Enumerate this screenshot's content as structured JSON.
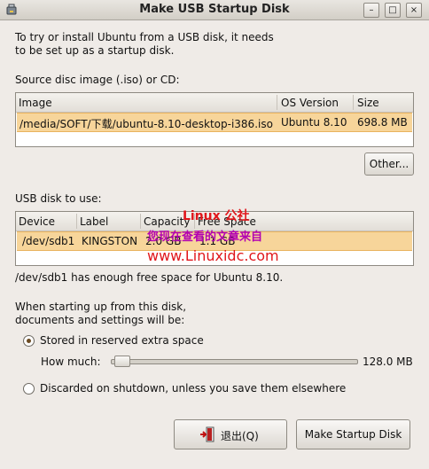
{
  "window": {
    "title": "Make USB Startup Disk"
  },
  "titlebar_buttons": {
    "minimize": "–",
    "maximize": "□",
    "close": "×"
  },
  "intro": {
    "line1": "To try or install Ubuntu from a USB disk, it needs",
    "line2": "to be set up as a startup disk."
  },
  "source": {
    "label": "Source disc image (.iso) or CD:",
    "columns": {
      "image": "Image",
      "os_version": "OS Version",
      "size": "Size"
    },
    "rows": [
      {
        "image": "/media/SOFT/下载/ubuntu-8.10-desktop-i386.iso",
        "os_version": "Ubuntu 8.10",
        "size": "698.8 MB"
      }
    ],
    "other_button": "Other..."
  },
  "usb": {
    "label": "USB disk to use:",
    "columns": {
      "device": "Device",
      "label": "Label",
      "capacity": "Capacity",
      "free_space": "Free Space"
    },
    "rows": [
      {
        "device": "/dev/sdb1",
        "label": "KINGSTON",
        "capacity": "2.0 GB",
        "free_space": "1.1 GB"
      }
    ],
    "status": "/dev/sdb1 has enough free space for Ubuntu 8.10."
  },
  "persistence": {
    "intro_line1": "When starting up from this disk,",
    "intro_line2": "documents and settings will be:",
    "option_stored": "Stored in reserved extra space",
    "how_much_label": "How much:",
    "how_much_value": "128.0 MB",
    "slider_fraction": 0.02,
    "option_discarded": "Discarded on shutdown, unless you save them elsewhere",
    "selected": "stored"
  },
  "buttons": {
    "quit": "退出(Q)",
    "make": "Make Startup Disk"
  },
  "watermark": {
    "line1": "Linux 公社",
    "line2": "您现在查看的文章来自",
    "line3": "www.Linuxidc.com"
  },
  "colors": {
    "selection": "#f7d59a",
    "watermark_red": "#e0161b",
    "watermark_purple": "#b200b2"
  }
}
